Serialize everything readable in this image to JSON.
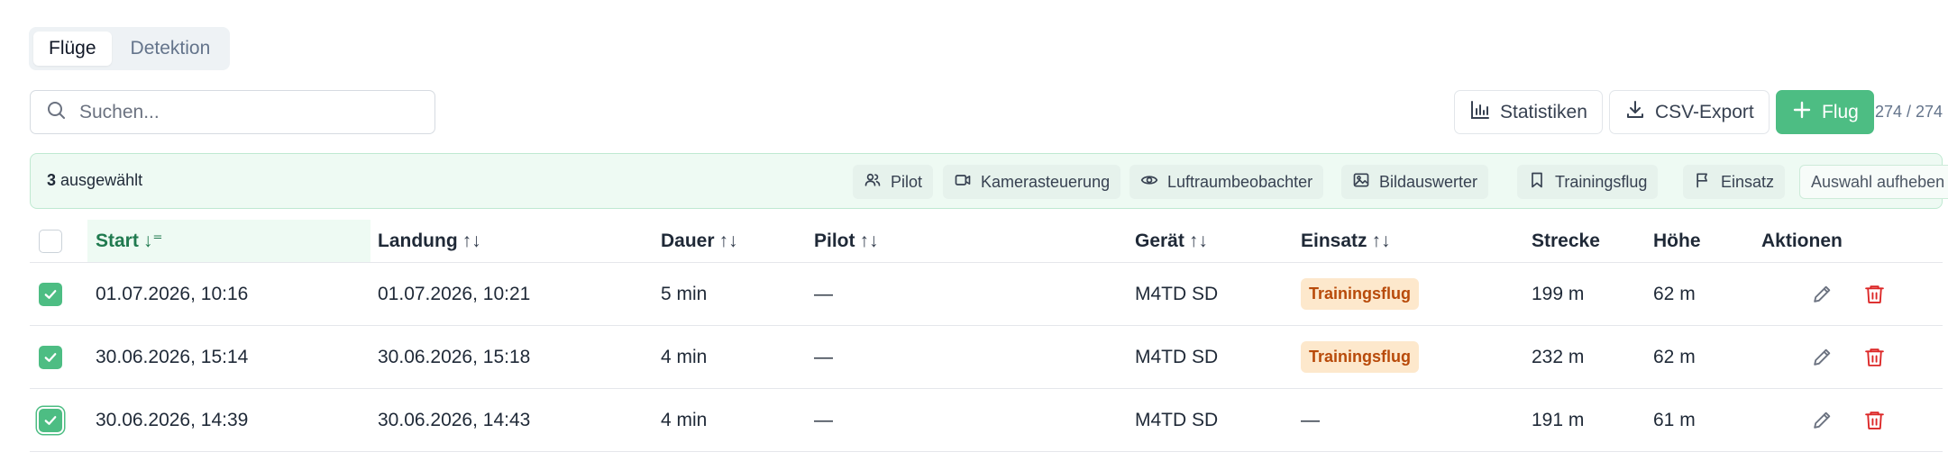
{
  "tabs": [
    {
      "label": "Flüge",
      "active": true
    },
    {
      "label": "Detektion",
      "active": false
    }
  ],
  "search": {
    "placeholder": "Suchen...",
    "value": ""
  },
  "toolbar": {
    "stats_label": "Statistiken",
    "csv_label": "CSV-Export",
    "add_label": "Flug",
    "count": "274 / 274"
  },
  "selection": {
    "count": "3",
    "suffix": "ausgewählt",
    "actions": [
      "Pilot",
      "Kamerasteuerung",
      "Luftraumbeobachter",
      "Bildauswerter",
      "Trainingsflug",
      "Einsatz"
    ],
    "clear_label": "Auswahl aufheben"
  },
  "table": {
    "headers": [
      "Start",
      "Landung",
      "Dauer",
      "Pilot",
      "Gerät",
      "Einsatz",
      "Strecke",
      "Höhe",
      "Aktionen"
    ],
    "sort_indicators": {
      "Start": "↓",
      "Landung": "↑↓",
      "Dauer": "↑↓",
      "Pilot": "↑↓",
      "Gerät": "↑↓",
      "Einsatz": "↑↓"
    },
    "rows": [
      {
        "checked": true,
        "start": "01.07.2026, 10:16",
        "landung": "01.07.2026, 10:21",
        "dauer": "5 min",
        "pilot": "—",
        "geraet": "M4TD SD",
        "einsatz": "Trainingsflug",
        "strecke": "199 m",
        "hoehe": "62 m"
      },
      {
        "checked": true,
        "start": "30.06.2026, 15:14",
        "landung": "30.06.2026, 15:18",
        "dauer": "4 min",
        "pilot": "—",
        "geraet": "M4TD SD",
        "einsatz": "Trainingsflug",
        "strecke": "232 m",
        "hoehe": "62 m"
      },
      {
        "checked": true,
        "start": "30.06.2026, 14:39",
        "landung": "30.06.2026, 14:43",
        "dauer": "4 min",
        "pilot": "—",
        "geraet": "M4TD SD",
        "einsatz": "—",
        "strecke": "191 m",
        "hoehe": "61 m"
      }
    ]
  },
  "colors": {
    "accent": "#4dbd83",
    "badge_bg": "#fde8cc",
    "badge_text": "#b84a0a",
    "delete": "#dc2626"
  }
}
